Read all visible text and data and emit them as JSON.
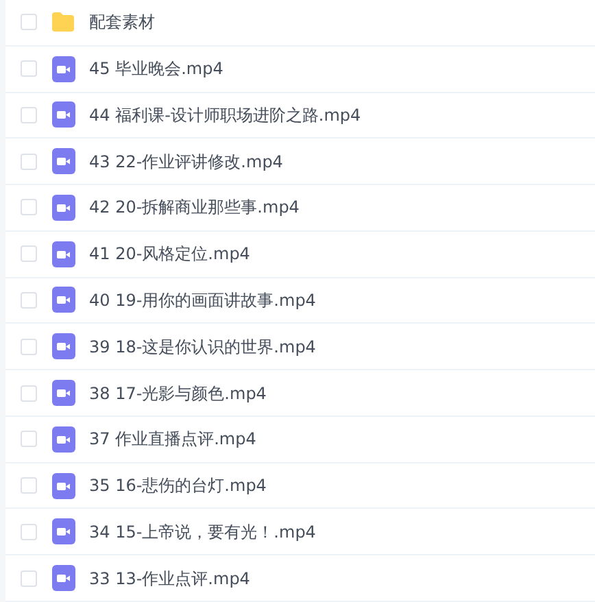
{
  "files": [
    {
      "kind": "folder",
      "name": "配套素材",
      "checked": false
    },
    {
      "kind": "video",
      "name": "45 毕业晚会.mp4",
      "checked": false
    },
    {
      "kind": "video",
      "name": "44 福利课-设计师职场进阶之路.mp4",
      "checked": false
    },
    {
      "kind": "video",
      "name": "43 22-作业评讲修改.mp4",
      "checked": false
    },
    {
      "kind": "video",
      "name": "42 20-拆解商业那些事.mp4",
      "checked": false
    },
    {
      "kind": "video",
      "name": "41 20-风格定位.mp4",
      "checked": false
    },
    {
      "kind": "video",
      "name": "40 19-用你的画面讲故事.mp4",
      "checked": false
    },
    {
      "kind": "video",
      "name": "39 18-这是你认识的世界.mp4",
      "checked": false
    },
    {
      "kind": "video",
      "name": "38 17-光影与颜色.mp4",
      "checked": false
    },
    {
      "kind": "video",
      "name": "37 作业直播点评.mp4",
      "checked": false
    },
    {
      "kind": "video",
      "name": "35 16-悲伤的台灯.mp4",
      "checked": false
    },
    {
      "kind": "video",
      "name": "34 15-上帝说，要有光！.mp4",
      "checked": false
    },
    {
      "kind": "video",
      "name": "33 13-作业点评.mp4",
      "checked": false
    }
  ]
}
